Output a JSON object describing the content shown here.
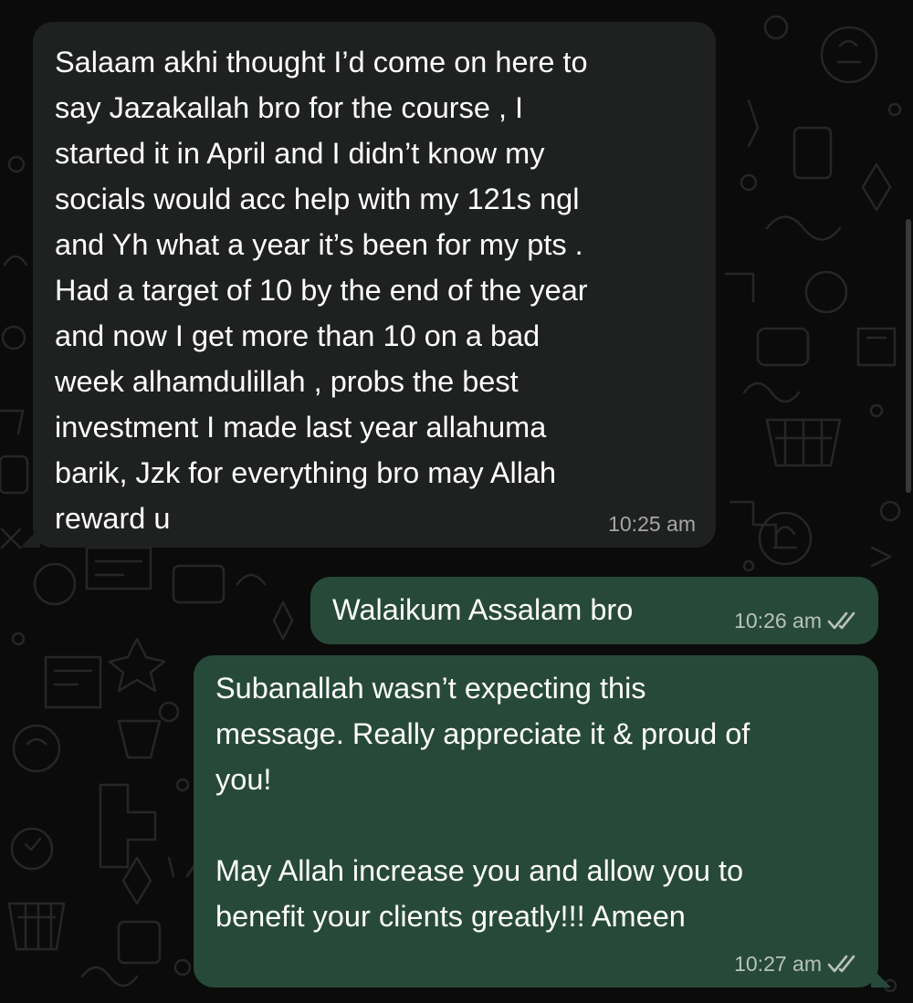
{
  "chat": {
    "messages": [
      {
        "direction": "incoming",
        "text": "Salaam akhi thought I’d come on here to\nsay Jazakallah bro for the course , I\nstarted it in April and I didn’t know my\nsocials would acc help with my 121s ngl\nand Yh what a year it’s been for my pts .\nHad a target of 10 by the end of the year\nand now I get more than 10 on a bad\nweek alhamdulillah , probs the best\ninvestment I made last year allahuma\nbarik, Jzk for everything bro may Allah\nreward u",
        "time": "10:25 am"
      },
      {
        "direction": "outgoing",
        "text": "Walaikum Assalam bro",
        "time": "10:26 am",
        "status_icon": "double-check-icon"
      },
      {
        "direction": "outgoing",
        "text": "Subanallah wasn’t expecting this\nmessage. Really appreciate it & proud of\nyou!\n\nMay Allah increase you and allow you to\nbenefit your clients greatly!!! Ameen",
        "time": "10:27 am",
        "status_icon": "double-check-icon"
      }
    ]
  },
  "colors": {
    "background": "#0b0b0b",
    "incoming_bubble": "#1f2020",
    "outgoing_bubble": "#27493a",
    "text": "#ffffff",
    "timestamp": "#a6a6a6"
  }
}
